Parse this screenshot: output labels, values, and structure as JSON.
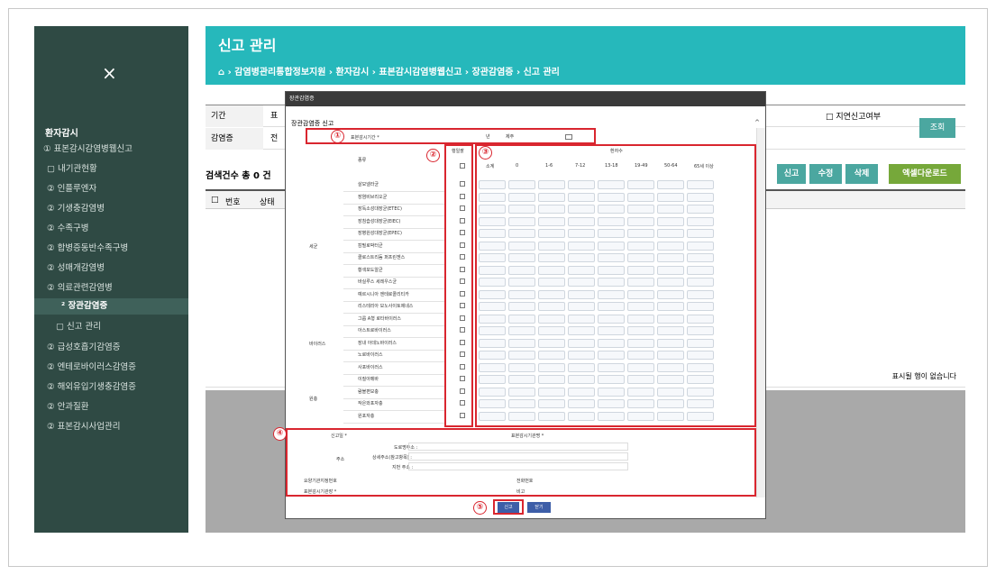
{
  "sidebar": {
    "close_glyph": "×",
    "section_title": "환자감시",
    "items": [
      {
        "bullet": "①",
        "label": "표본감시감염병웹신고"
      },
      {
        "bullet": "",
        "label": "내기관현황"
      },
      {
        "bullet": "②",
        "label": "인플루엔자"
      },
      {
        "bullet": "②",
        "label": "기생충감염병"
      },
      {
        "bullet": "②",
        "label": "수족구병"
      },
      {
        "bullet": "②",
        "label": "합병증동반수족구병"
      },
      {
        "bullet": "②",
        "label": "성매개감염병"
      },
      {
        "bullet": "②",
        "label": "의료관련감염병"
      },
      {
        "bullet": "²",
        "label": "장관감염증"
      },
      {
        "bullet": "",
        "label": "신고 관리"
      },
      {
        "bullet": "②",
        "label": "급성호흡기감염증"
      },
      {
        "bullet": "②",
        "label": "엔테로바이러스감염증"
      },
      {
        "bullet": "②",
        "label": "해외유입기생충감염증"
      },
      {
        "bullet": "②",
        "label": "안과질환"
      },
      {
        "bullet": "②",
        "label": "표본감시사업관리"
      }
    ]
  },
  "header": {
    "title": "신고 관리",
    "breadcrumb": "⌂ › 감염병관리통합정보지원 › 환자감시 › 표본감시감염병웹신고 › 장관감염증 › 신고 관리"
  },
  "filter": {
    "period_label": "기간",
    "period_value": "표",
    "disease_label": "감염증",
    "disease_value": "전",
    "self_report_label": "□ 지연신고여부",
    "search_button": "조회"
  },
  "results": {
    "count_text": "검색건수 총 0 건",
    "buttons": [
      "신고",
      "수정",
      "삭제",
      "엑셀다운로드"
    ],
    "columns": [
      "□",
      "번호",
      "상태"
    ],
    "no_data": "표시될 행이 없습니다"
  },
  "modal": {
    "title": "장관감염증",
    "subtitle": "장관감염증 신고",
    "period_label": "표본감시기간 *",
    "year_unit": "년",
    "week_unit": "제주",
    "col_group": "종류",
    "col_check": "행일괄",
    "patient_count": "환자수",
    "age_cols": [
      "소계",
      "0",
      "1-6",
      "7-12",
      "13-18",
      "19-49",
      "50-64",
      "65세 이상"
    ],
    "groups": [
      {
        "name": "세균",
        "rows": [
          "살모넬라균",
          "장염비브리오균",
          "장독소성대장균(ETEC)",
          "장침습성대장균(EIEC)",
          "장병원성대장균(EPEC)",
          "캄필로박터균",
          "클로스트리듐 퍼프린젠스",
          "황색포도알균",
          "바실루스 세레우스균",
          "예르시니아 엔테로콜리티카",
          "리스테리아 모노사이토제네스"
        ]
      },
      {
        "name": "바이러스",
        "rows": [
          "그룹 A형 로타바이러스",
          "아스트로바이러스",
          "장내 아데노바이러스",
          "노로바이러스",
          "사포바이러스"
        ]
      },
      {
        "name": "원충",
        "rows": [
          "이질아메바",
          "람블편모충",
          "작은와포자충",
          "원포자충"
        ]
      }
    ],
    "reporter_label": "신고일 *",
    "institution_label": "표본감시기관명 *",
    "address_label": "주소",
    "road_label": "도로명주소 :",
    "detail_label": "상세주소(참고항목) :",
    "lot_label": "지번 주소 :",
    "care_no_label": "요양기관지정번호",
    "phone_label": "전화번호",
    "manager_label": "표본감시기관장 *",
    "note_label": "비고",
    "submit_button": "신고",
    "close_button": "닫기",
    "markers": [
      "①",
      "②",
      "③",
      "④",
      "⑤"
    ]
  },
  "colors": {
    "sidebar_bg": "#2f4a44",
    "header_bg": "#26b8bb",
    "accent_red": "#d9262f",
    "btn_teal": "#4ba7a0",
    "btn_green": "#76a83a"
  }
}
